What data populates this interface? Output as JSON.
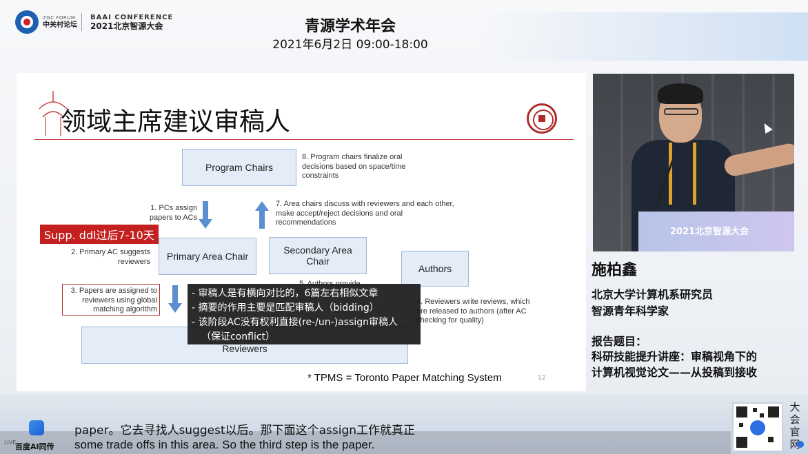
{
  "header": {
    "zgc_forum_label": "ZGC FORUM",
    "zgc_forum_cn": "中关村论坛",
    "baai_label": "BAAI CONFERENCE",
    "baai_cn": "2021北京智源大会",
    "event_title": "青源学术年会",
    "event_time": "2021年6月2日   09:00-18:00"
  },
  "slide": {
    "title": "领域主席建议审稿人",
    "boxes": {
      "program_chairs": "Program Chairs",
      "primary_area_chair": "Primary Area Chair",
      "secondary_area_chair": "Secondary Area Chair",
      "authors": "Authors",
      "reviewers": "Reviewers"
    },
    "notes": {
      "step8": "8. Program chairs finalize oral decisions based on space/time constraints",
      "step1": "1. PCs assign papers to ACs",
      "step7": "7. Area chairs discuss with reviewers and each other, make accept/reject decisions and oral recommendations",
      "step2": "2. Primary AC suggests reviewers",
      "step3": "3. Papers are assigned to reviewers using global matching algorithm",
      "step5": "5. Authors provide",
      "step4": "4. Reviewers write reviews, which are released to authors (after AC checking for quality)"
    },
    "supp_badge": "Supp. ddl过后7-10天",
    "overlay_items": [
      "-   审稿人是有横向对比的，6篇左右相似文章",
      "-   摘要的作用主要是匹配审稿人（bidding）",
      "-   该阶段AC没有权利直接(re-/un-)assign审稿人（保证conflict）"
    ],
    "footnote": "* TPMS = Toronto Paper Matching System",
    "page_number": "12"
  },
  "video": {
    "podium_text": "2021北京智源大会"
  },
  "speaker": {
    "name": "施柏鑫",
    "title_line1": "北京大学计算机系研究员",
    "title_line2": "智源青年科学家",
    "report_label": "报告题目：",
    "report_line1": "科研技能提升讲座：审稿视角下的",
    "report_line2": "计算机视觉论文——从投稿到接收"
  },
  "footer": {
    "live_label": "LIVE",
    "baidu_label": "百度AI同传",
    "subtitle_cn": "paper。它去寻找人suggest以后。那下面这个assign工作就真正",
    "subtitle_en": "some trade offs in this area. So the third step is the paper.",
    "qr_side_text": "大会官网"
  },
  "colors": {
    "accent_red": "#c4201f",
    "box_fill": "#e3ecf7",
    "arrow_blue": "#5b8fd0"
  }
}
